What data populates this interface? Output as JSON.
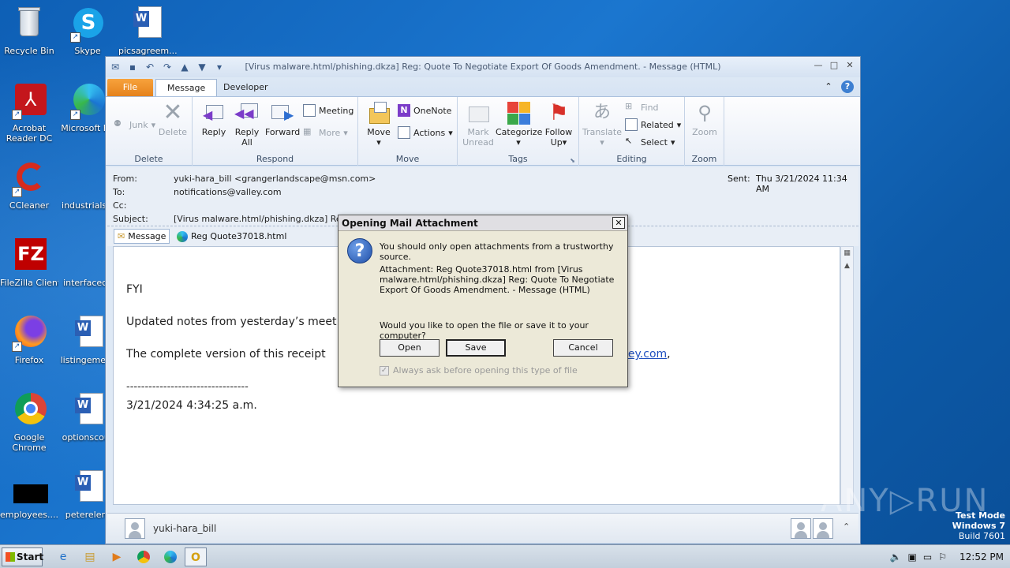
{
  "desktop": {
    "icons": [
      {
        "label": "Recycle Bin"
      },
      {
        "label": "Skype"
      },
      {
        "label": "picsagreem..."
      },
      {
        "label": "Acrobat Reader DC"
      },
      {
        "label": "Microsoft Ed"
      },
      {
        "label": "CCleaner"
      },
      {
        "label": "industrialstr"
      },
      {
        "label": "FileZilla Client"
      },
      {
        "label": "interfaceco"
      },
      {
        "label": "Firefox"
      },
      {
        "label": "listingemerg"
      },
      {
        "label": "Google Chrome"
      },
      {
        "label": "optionscour"
      },
      {
        "label": "employees...."
      },
      {
        "label": "peterelem"
      }
    ]
  },
  "window": {
    "title": "[Virus malware.html/phishing.dkza] Reg: Quote To Negotiate Export Of Goods Amendment. - Message (HTML)",
    "tabs": {
      "file": "File",
      "message": "Message",
      "developer": "Developer"
    }
  },
  "ribbon": {
    "delete_group": {
      "label": "Delete",
      "junk": "Junk",
      "delete": "Delete"
    },
    "respond_group": {
      "label": "Respond",
      "reply": "Reply",
      "reply_all_1": "Reply",
      "reply_all_2": "All",
      "forward": "Forward",
      "meeting": "Meeting",
      "more": "More"
    },
    "move_group": {
      "label": "Move",
      "move": "Move",
      "onenote": "OneNote",
      "actions": "Actions"
    },
    "tags_group": {
      "label": "Tags",
      "mark_unread_1": "Mark",
      "mark_unread_2": "Unread",
      "categorize": "Categorize",
      "follow_up_1": "Follow",
      "follow_up_2": "Up"
    },
    "editing_group": {
      "label": "Editing",
      "translate": "Translate",
      "find": "Find",
      "related": "Related",
      "select": "Select"
    },
    "zoom_group": {
      "label": "Zoom",
      "zoom": "Zoom"
    }
  },
  "header": {
    "from_label": "From:",
    "from_value": "yuki-hara_bill <grangerlandscape@msn.com>",
    "to_label": "To:",
    "to_value": "notifications@valley.com",
    "cc_label": "Cc:",
    "subject_label": "Subject:",
    "subject_value": "[Virus malware.html/phishing.dkza] Reg:",
    "sent_label": "Sent:",
    "sent_value": "Thu 3/21/2024 11:34 AM",
    "attachments": {
      "message": "Message",
      "file": "Reg Quote37018.html"
    }
  },
  "body": {
    "line1": "FYI",
    "line2": "Updated notes from yesterday’s meet",
    "line3": "The complete version of this receipt",
    "link_tail": "ley.com",
    "comma": ",",
    "separator": "---------------------------------",
    "timestamp": "3/21/2024 4:34:25 a.m."
  },
  "people_pane": {
    "name": "yuki-hara_bill"
  },
  "dialog": {
    "title": "Opening Mail Attachment",
    "warning": "You should only open attachments from a trustworthy source.",
    "attachment_line1": "Attachment: Reg Quote37018.html from [Virus",
    "attachment_line2": "malware.html/phishing.dkza] Reg: Quote To Negotiate",
    "attachment_line3": "Export Of Goods Amendment. - Message (HTML)",
    "question": "Would you like to open the file or save it to your computer?",
    "open": "Open",
    "save": "Save",
    "cancel": "Cancel",
    "checkbox": "Always ask before opening this type of file",
    "checked": true
  },
  "taskbar": {
    "start": "Start",
    "clock": "12:52 PM"
  },
  "watermark": {
    "line1": "Test Mode",
    "line2": "Windows 7",
    "line3": "Build 7601",
    "brand": "ANY RUN"
  }
}
